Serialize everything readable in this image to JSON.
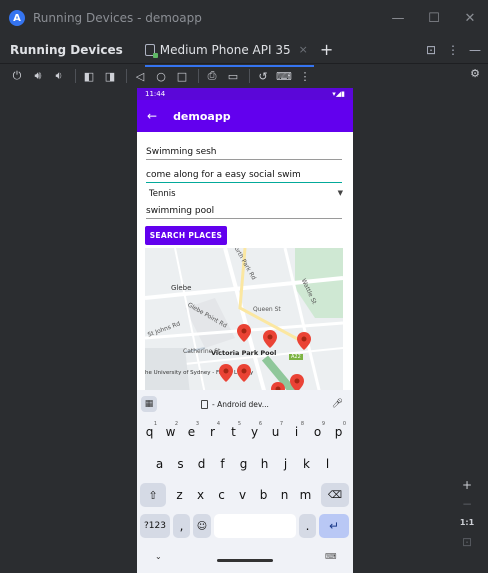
{
  "window": {
    "title": "Running Devices - demoapp",
    "app_icon": "A",
    "controls": [
      "minimize-icon",
      "maximize-icon",
      "close-icon"
    ]
  },
  "tabbar": {
    "tool_title": "Running Devices",
    "device_tab": "Medium Phone API 35",
    "close_tab": "×",
    "add_tab": "+"
  },
  "phone": {
    "status_time": "11:44",
    "app_title": "demoapp",
    "fields": {
      "title_value": "Swimming sesh",
      "description_value": "come along for a easy social swim",
      "category_selected": "Tennis",
      "location_value": "swimming pool"
    },
    "search_button": "SEARCH PLACES",
    "map": {
      "labels": {
        "glebe": "Glebe",
        "victoria_park_pool": "Victoria Park Pool",
        "university_library": "he University of Sydney - Fisher Library",
        "north_park_rd": "North Park Rd",
        "wattle_st": "Wattle St",
        "glebe_point_rd": "Glebe Point Rd",
        "queen_st": "Queen St",
        "catherine_st": "Catherine St",
        "st_johns_rd": "St Johns Rd",
        "a22": "A22"
      }
    },
    "keyboard": {
      "suggestion": "- Android dev...",
      "row1": [
        "q",
        "w",
        "e",
        "r",
        "t",
        "y",
        "u",
        "i",
        "o",
        "p"
      ],
      "row1_hints": [
        "1",
        "2",
        "3",
        "4",
        "5",
        "6",
        "7",
        "8",
        "9",
        "0"
      ],
      "row2": [
        "a",
        "s",
        "d",
        "f",
        "g",
        "h",
        "j",
        "k",
        "l"
      ],
      "row3": [
        "z",
        "x",
        "c",
        "v",
        "b",
        "n",
        "m"
      ],
      "sym_key": "?123",
      "comma_key": ",",
      "period_key": ".",
      "enter_key": "↵"
    }
  },
  "rail": {
    "plus": "+",
    "minus": "−",
    "one_to_one": "1:1"
  },
  "colors": {
    "app_primary": "#6200ee",
    "status_bar": "#5b07d8",
    "accent_teal": "#03a99a",
    "ide_bg": "#2b2d30",
    "pin_red": "#ea4335"
  }
}
